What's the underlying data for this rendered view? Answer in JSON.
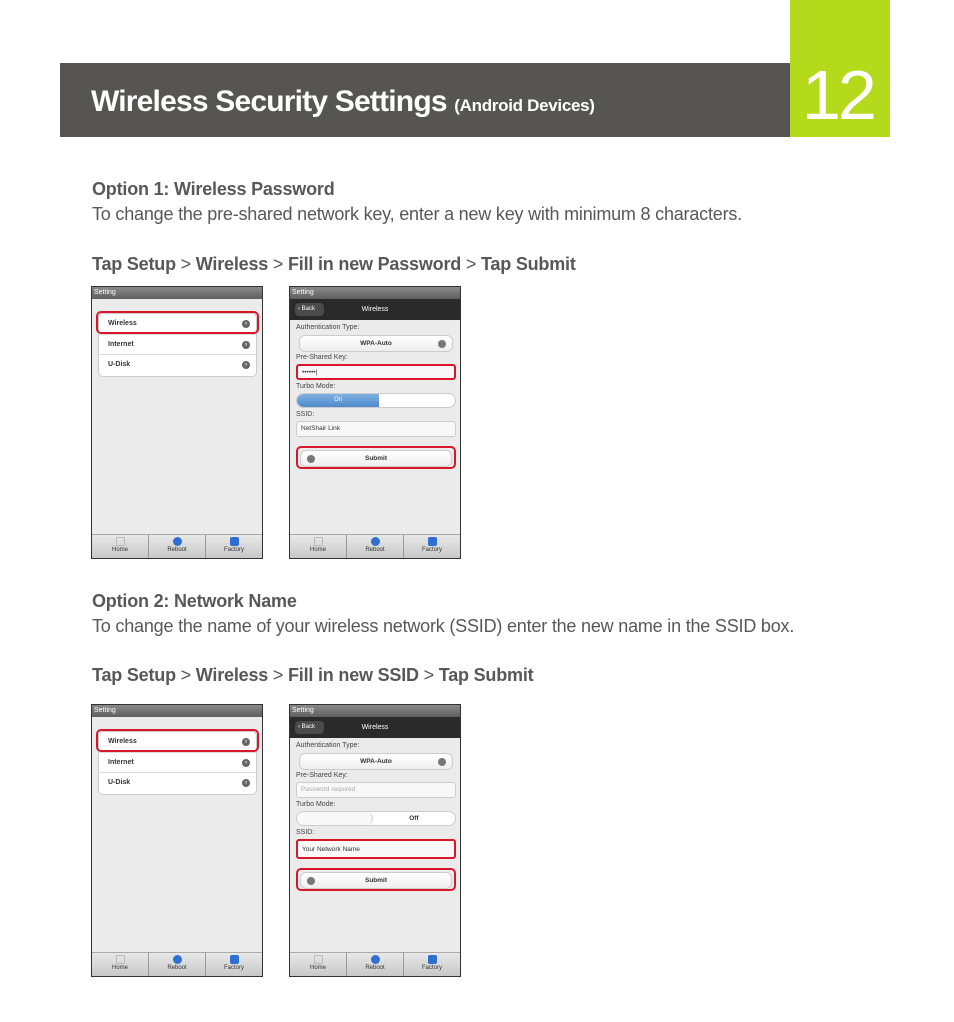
{
  "header": {
    "title": "Wireless Security Settings",
    "subtitle": "(Android Devices)",
    "page_number": "12",
    "colors": {
      "bar": "#575553",
      "accent": "#b5d91b",
      "highlight": "#d7182a"
    }
  },
  "option1": {
    "title": "Option 1: Wireless Password",
    "description": "To change the pre-shared network key, enter a new key with minimum 8 characters.",
    "steps": [
      {
        "text": "Tap Setup",
        "bold": true
      },
      {
        "text": " > ",
        "bold": false
      },
      {
        "text": "Wireless",
        "bold": true
      },
      {
        "text": " > ",
        "bold": false
      },
      {
        "text": "Fill in new Password",
        "bold": true
      },
      {
        "text": " > ",
        "bold": false
      },
      {
        "text": "Tap Submit",
        "bold": true
      }
    ]
  },
  "option2": {
    "title": "Option 2: Network Name",
    "description": "To change the name of your wireless network (SSID) enter the new name in the SSID box.",
    "steps": [
      {
        "text": "Tap Setup",
        "bold": true
      },
      {
        "text": " > ",
        "bold": false
      },
      {
        "text": "Wireless",
        "bold": true
      },
      {
        "text": " > ",
        "bold": false
      },
      {
        "text": "Fill in new SSID",
        "bold": true
      },
      {
        "text": " > ",
        "bold": false
      },
      {
        "text": "Tap Submit",
        "bold": true
      }
    ]
  },
  "phone": {
    "status_title": "Setting",
    "menu_items": [
      "Wireless",
      "Internet",
      "U-Disk"
    ],
    "back_label": "Back",
    "nav_title": "Wireless",
    "auth_label": "Authentication Type:",
    "auth_value": "WPA-Auto",
    "psk_label": "Pre-Shared Key:",
    "turbo_label": "Turbo Mode:",
    "ssid_label": "SSID:",
    "submit_label": "Submit",
    "tabs": [
      "Home",
      "Reboot",
      "Factory"
    ]
  },
  "screen1b": {
    "psk_value": "••••••|",
    "turbo_value": "On",
    "ssid_value": "NetShair Link"
  },
  "screen2b": {
    "psk_placeholder": "Password required",
    "turbo_value": "Off",
    "ssid_value": "Your Network Name"
  }
}
